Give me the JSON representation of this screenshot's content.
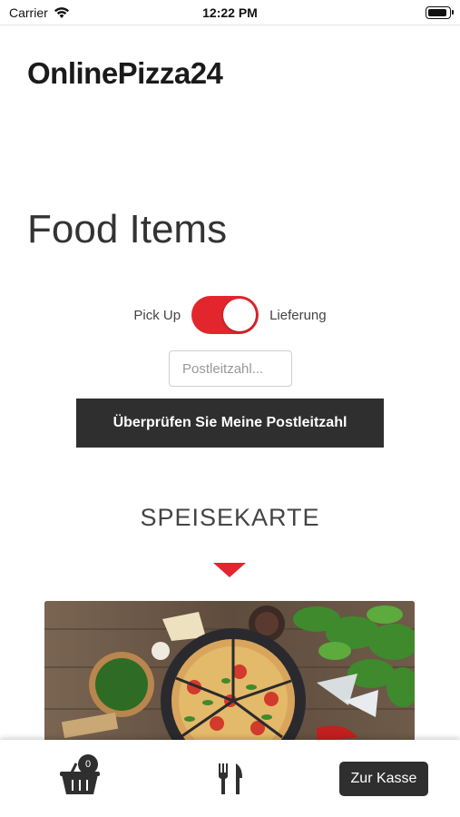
{
  "status_bar": {
    "carrier": "Carrier",
    "time": "12:22 PM"
  },
  "header": {
    "brand": "OnlinePizza24"
  },
  "main": {
    "title": "Food Items",
    "toggle": {
      "left_label": "Pick Up",
      "right_label": "Lieferung",
      "state": "on",
      "color": "#e3262e"
    },
    "zip_field": {
      "placeholder": "Postleitzahl...",
      "value": ""
    },
    "check_button_label": "Überprüfen Sie Meine Postleitzahl",
    "section_title": "SPEISEKARTE",
    "hero_image": "pizza-table-photo"
  },
  "tab_bar": {
    "cart_count": "0",
    "cart_icon": "basket-icon",
    "menu_icon": "fork-knife-icon",
    "checkout_label": "Zur Kasse"
  }
}
